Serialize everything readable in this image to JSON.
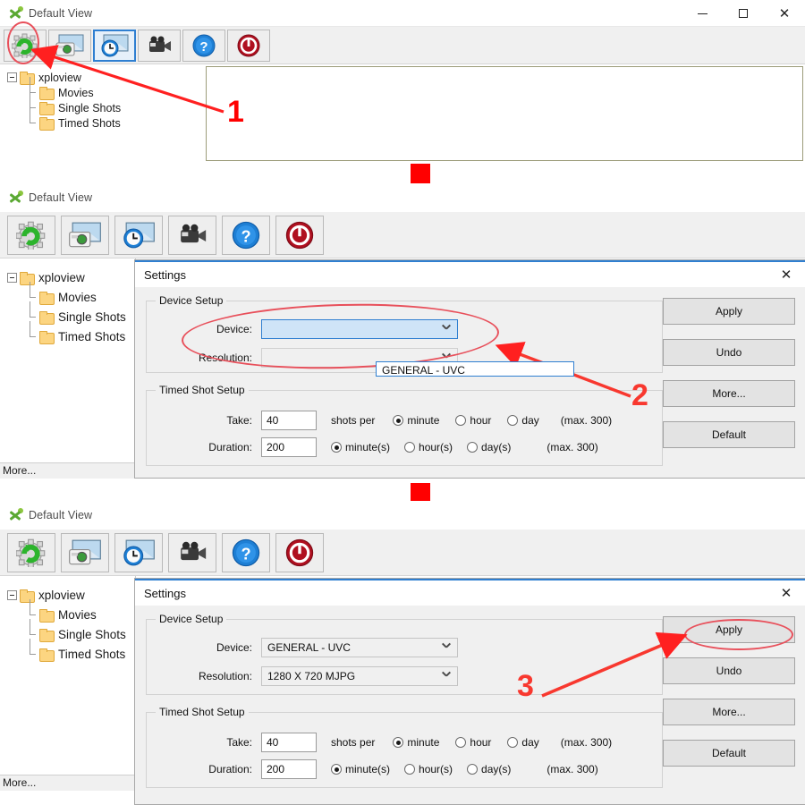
{
  "app": {
    "title": "Default View",
    "logo_icon": "xploview-logo-icon"
  },
  "window_controls": {
    "minimize": "minimize-icon",
    "maximize": "maximize-icon",
    "close": "close-icon"
  },
  "toolbar": {
    "buttons": [
      {
        "name": "settings-gear-button",
        "icon": "gear-refresh-icon",
        "selected": false
      },
      {
        "name": "single-shot-button",
        "icon": "photo-camera-icon",
        "selected": false
      },
      {
        "name": "timed-shot-button",
        "icon": "photo-clock-icon",
        "selected": true
      },
      {
        "name": "movie-button",
        "icon": "video-camera-icon",
        "selected": false
      },
      {
        "name": "help-button",
        "icon": "question-mark-icon",
        "selected": false
      },
      {
        "name": "exit-button",
        "icon": "power-icon",
        "selected": false
      }
    ]
  },
  "tree": {
    "root": "xploview",
    "children": [
      "Movies",
      "Single Shots",
      "Timed Shots"
    ],
    "more_label": "More..."
  },
  "settings": {
    "title": "Settings",
    "close_icon": "close-icon",
    "device_setup": {
      "legend": "Device Setup",
      "device_label": "Device:",
      "device_value_open": "",
      "device_value_set": "GENERAL - UVC",
      "device_option": "GENERAL - UVC",
      "resolution_label": "Resolution:",
      "resolution_value_empty": "",
      "resolution_value_set": "1280 X 720 MJPG"
    },
    "timed_shot_setup": {
      "legend": "Timed Shot Setup",
      "take_label": "Take:",
      "take_value": "40",
      "shots_per_label": "shots per",
      "take_units": [
        {
          "label": "minute",
          "selected": true
        },
        {
          "label": "hour",
          "selected": false
        },
        {
          "label": "day",
          "selected": false
        }
      ],
      "take_max": "(max. 300)",
      "duration_label": "Duration:",
      "duration_value": "200",
      "duration_units": [
        {
          "label": "minute(s)",
          "selected": true
        },
        {
          "label": "hour(s)",
          "selected": false
        },
        {
          "label": "day(s)",
          "selected": false
        }
      ],
      "duration_max": "(max. 300)"
    },
    "buttons": {
      "apply": "Apply",
      "undo": "Undo",
      "more": "More...",
      "default": "Default"
    }
  },
  "annotations": {
    "step1": "1",
    "step2": "2",
    "step3": "3",
    "arrow_color": "#ff0000",
    "ellipse_color": "#e8505b",
    "flow_arrow_icon": "down-arrow-icon"
  }
}
